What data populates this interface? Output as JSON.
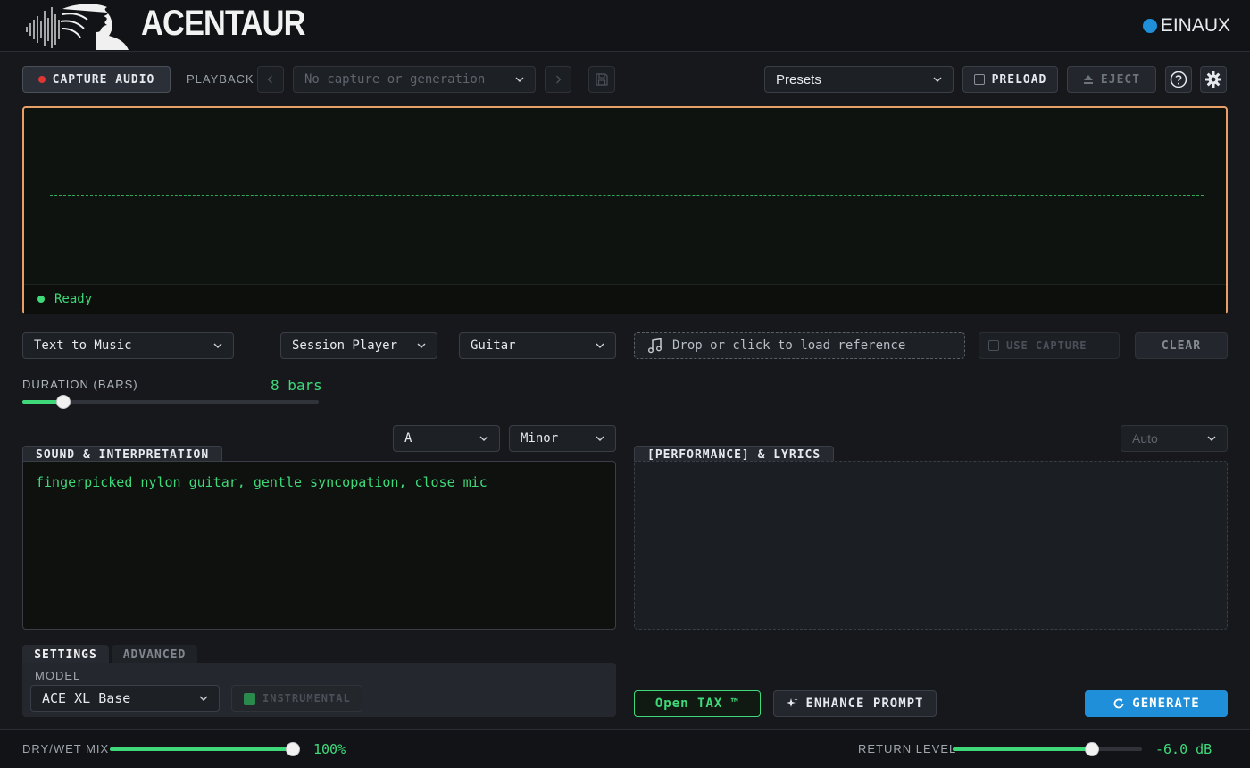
{
  "header": {
    "brand": "ACENTAUR",
    "partner": "EINAUX"
  },
  "toolbar": {
    "capture_label": "CAPTURE AUDIO",
    "playback_label": "PLAYBACK",
    "history_placeholder": "No capture or generation",
    "presets_label": "Presets",
    "preload_label": "PRELOAD",
    "eject_label": "EJECT"
  },
  "waveform": {
    "status": "Ready",
    "frame_color": "#e8a068",
    "line_color": "#2fa85a"
  },
  "mode_row": {
    "mode": "Text to Music",
    "player": "Session Player",
    "instrument": "Guitar",
    "reference_text": "Drop or click to load reference",
    "use_capture_label": "USE CAPTURE",
    "clear_label": "CLEAR"
  },
  "duration": {
    "label": "DURATION (BARS)",
    "value_text": "8 bars",
    "slider_fraction": 0.14
  },
  "key": {
    "root": "A",
    "scale": "Minor",
    "language": "Auto"
  },
  "sound": {
    "tab_label": "SOUND & INTERPRETATION",
    "text": "fingerpicked nylon guitar, gentle syncopation, close mic"
  },
  "lyrics": {
    "tab_label": "[PERFORMANCE] & LYRICS",
    "text": ""
  },
  "settings": {
    "tab_settings": "SETTINGS",
    "tab_advanced": "ADVANCED",
    "model_label": "MODEL",
    "model_value": "ACE XL Base",
    "instrumental_label": "INSTRUMENTAL"
  },
  "actions": {
    "tax_label": "Open TAX ™",
    "enhance_label": "ENHANCE PROMPT",
    "generate_label": "GENERATE"
  },
  "footer": {
    "drywet_label": "DRY/WET MIX",
    "drywet_value": "100%",
    "drywet_fraction": 1.0,
    "return_label": "RETURN LEVEL",
    "return_value": "-6.0 dB",
    "return_fraction": 0.74
  },
  "colors": {
    "accent_green": "#3fd97a",
    "accent_blue": "#1e8fd8",
    "record_red": "#e03535",
    "background": "#16181c"
  },
  "icons": [
    "logo-art",
    "record-dot",
    "chevron-left-icon",
    "chevron-right-icon",
    "save-icon",
    "chevron-down-icon",
    "eject-icon",
    "help-icon",
    "gear-icon",
    "music-note-icon",
    "sparkle-icon",
    "refresh-icon"
  ]
}
